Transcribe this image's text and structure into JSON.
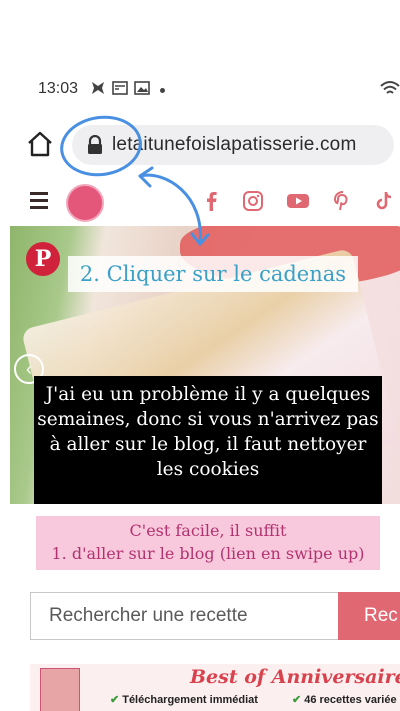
{
  "status_bar": {
    "time": "13:03"
  },
  "browser": {
    "url": "letaitunefoislapatisserie.com"
  },
  "annotations": {
    "step2": "2. Cliquer sur le cadenas",
    "black_caption": "J'ai eu un problème il y a quelques semaines, donc si vous n'arrivez pas à aller sur le blog, il faut nettoyer les cookies",
    "pink_line1": "C'est facile, il suffit",
    "pink_line2": "1. d'aller sur le blog (lien en swipe up)"
  },
  "search": {
    "placeholder": "Rechercher une recette",
    "button_label": "Rec"
  },
  "banner": {
    "title": "Best of Anniversaire",
    "feature1": "Téléchargement immédiat",
    "feature2": "46 recettes variée"
  },
  "colors": {
    "accent": "#e06872",
    "annotation_blue": "#4a90e2",
    "pink_caption_bg": "#f8c9dd"
  }
}
